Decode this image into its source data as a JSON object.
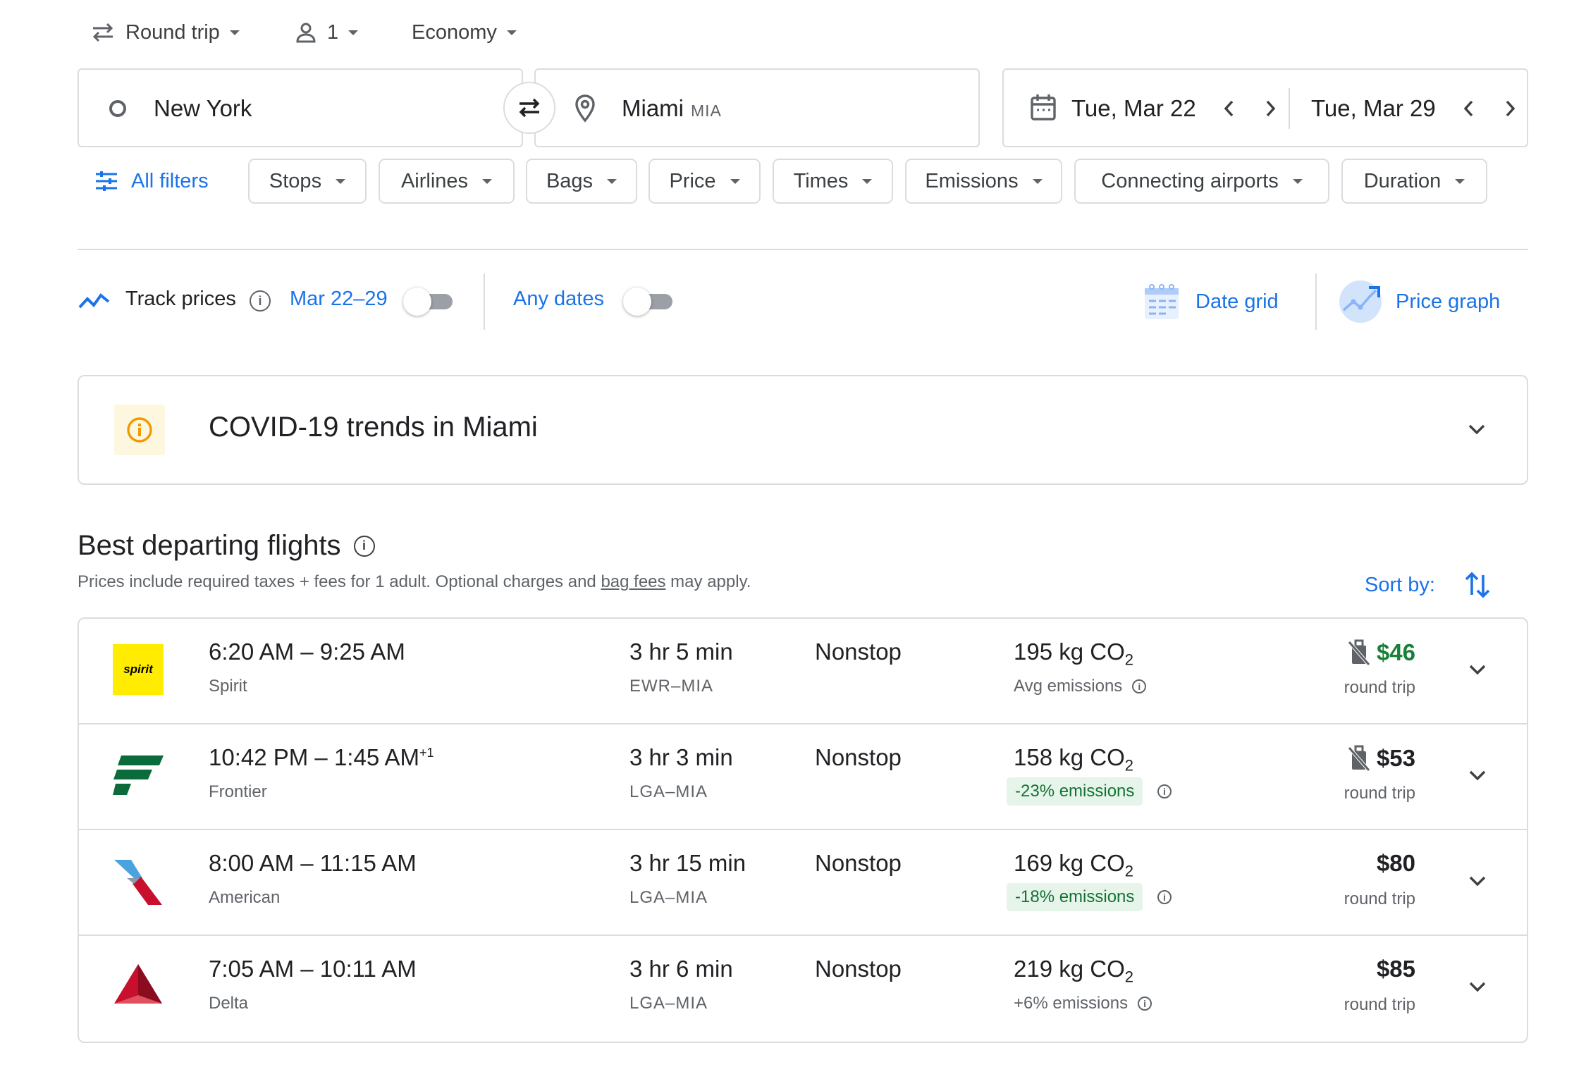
{
  "top": {
    "trip_type": "Round trip",
    "passengers": "1",
    "cabin": "Economy"
  },
  "search": {
    "origin": "New York",
    "destination": "Miami",
    "destination_code": "MIA",
    "depart_date": "Tue, Mar 22",
    "return_date": "Tue, Mar 29"
  },
  "filters": {
    "all_filters": "All filters",
    "chips": [
      "Stops",
      "Airlines",
      "Bags",
      "Price",
      "Times",
      "Emissions",
      "Connecting airports",
      "Duration"
    ]
  },
  "tools": {
    "track_prices": "Track prices",
    "track_range": "Mar 22–29",
    "any_dates": "Any dates",
    "date_grid": "Date grid",
    "price_graph": "Price graph"
  },
  "covid": {
    "title": "COVID-19 trends in Miami"
  },
  "results": {
    "heading": "Best departing flights",
    "note_prefix": "Prices include required taxes + fees for 1 adult. Optional charges and ",
    "note_link": "bag fees",
    "note_suffix": " may apply.",
    "sort_label": "Sort by:",
    "flights": [
      {
        "times": "6:20 AM – 9:25 AM",
        "times_suffix": "",
        "airline": "Spirit",
        "duration": "3 hr 5 min",
        "route": "EWR–MIA",
        "stops": "Nonstop",
        "co2": "195 kg CO",
        "co2_sub": "2",
        "emissions": "Avg emissions",
        "price": "$46",
        "price_note": "round trip"
      },
      {
        "times": "10:42 PM – 1:45 AM",
        "times_suffix": "+1",
        "airline": "Frontier",
        "duration": "3 hr 3 min",
        "route": "LGA–MIA",
        "stops": "Nonstop",
        "co2": "158 kg CO",
        "co2_sub": "2",
        "emissions": "-23% emissions",
        "price": "$53",
        "price_note": "round trip"
      },
      {
        "times": "8:00 AM – 11:15 AM",
        "times_suffix": "",
        "airline": "American",
        "duration": "3 hr 15 min",
        "route": "LGA–MIA",
        "stops": "Nonstop",
        "co2": "169 kg CO",
        "co2_sub": "2",
        "emissions": "-18% emissions",
        "price": "$80",
        "price_note": "round trip"
      },
      {
        "times": "7:05 AM – 10:11 AM",
        "times_suffix": "",
        "airline": "Delta",
        "duration": "3 hr 6 min",
        "route": "LGA–MIA",
        "stops": "Nonstop",
        "co2": "219 kg CO",
        "co2_sub": "2",
        "emissions": "+6% emissions",
        "price": "$85",
        "price_note": "round trip"
      }
    ]
  },
  "logos": {
    "spirit_text": "spirit"
  },
  "colors": {
    "accent": "#1a73e8",
    "price_green": "#188038",
    "emissions_badge_bg": "#e6f4ea",
    "spirit_yellow": "#ffec00",
    "frontier_green": "#0b6b3a",
    "delta_red": "#c8102e"
  }
}
